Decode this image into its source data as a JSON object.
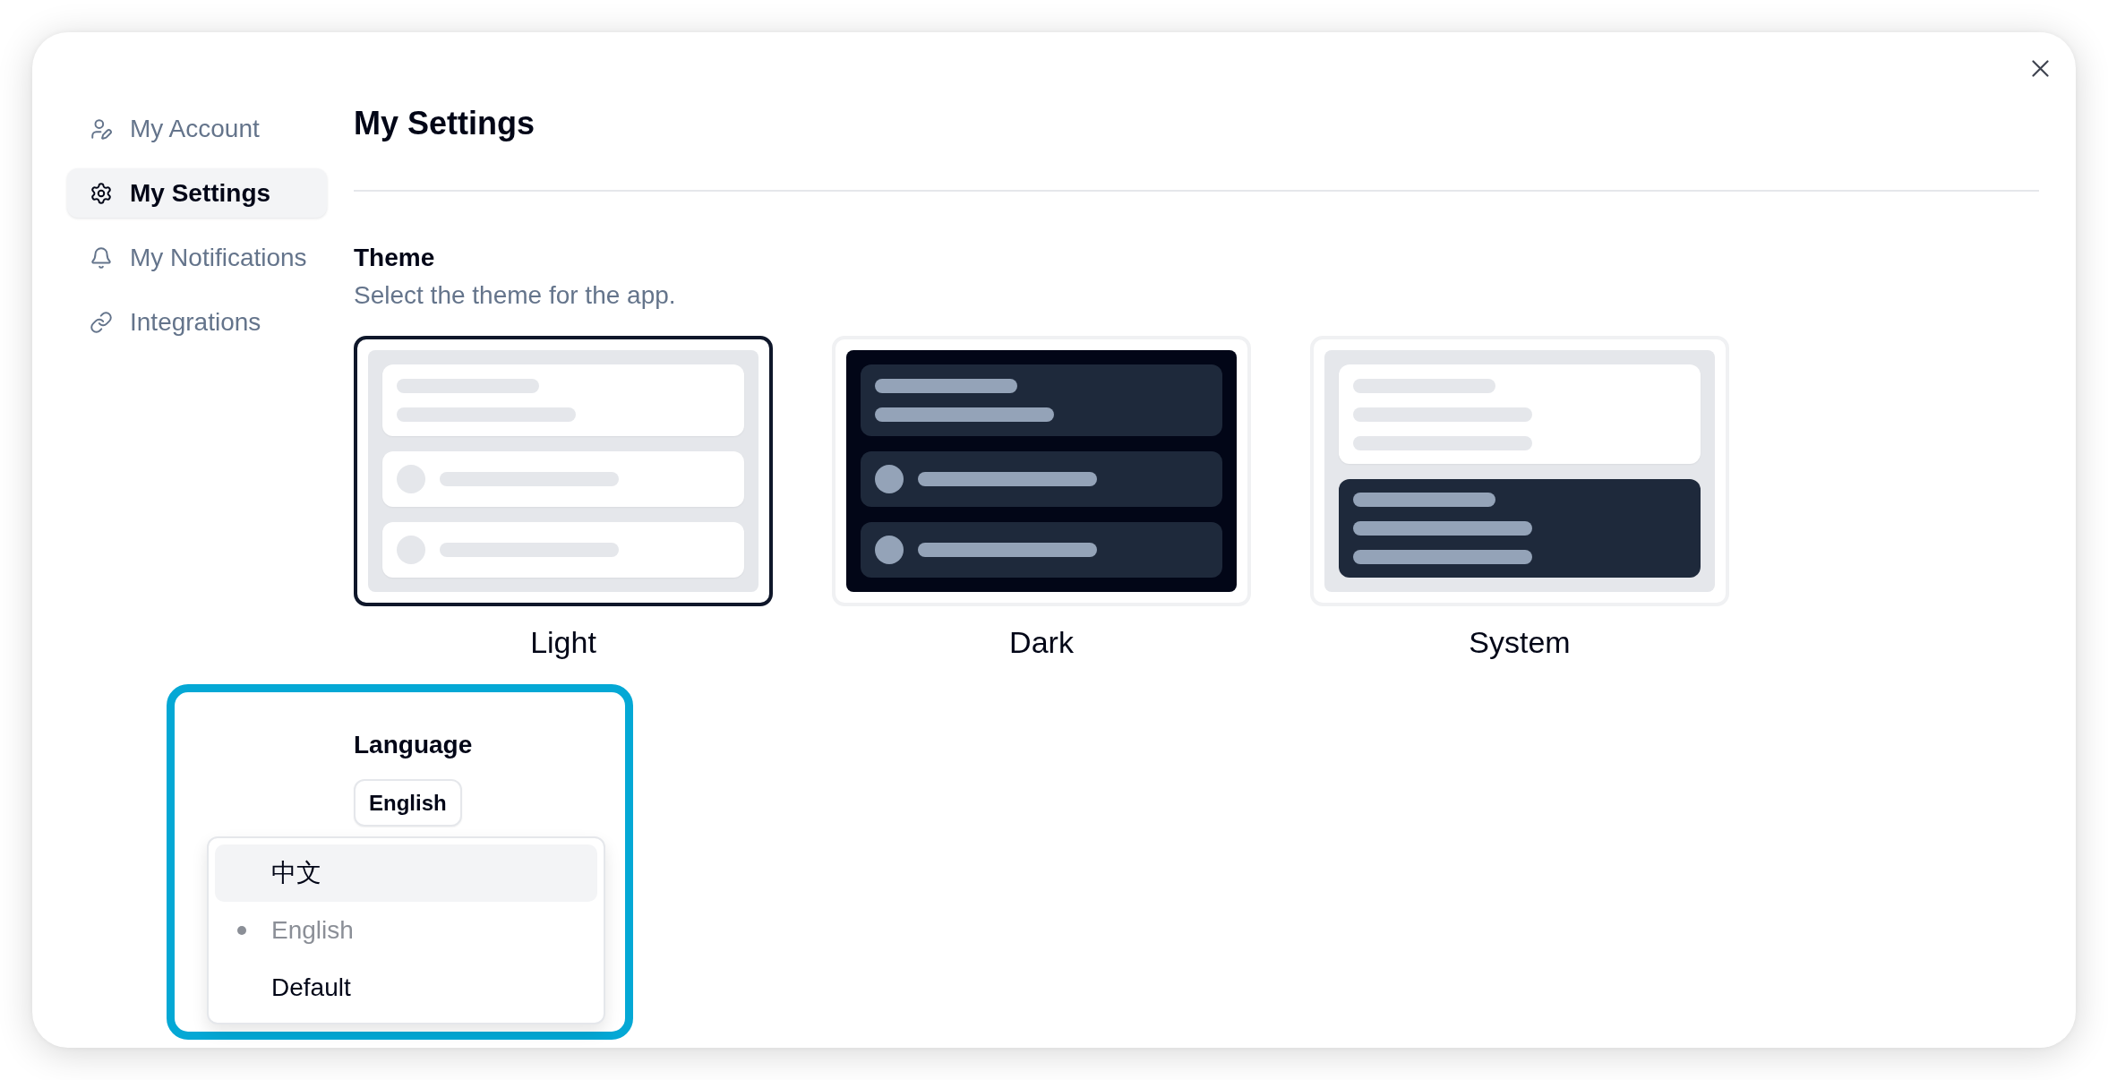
{
  "sidebar": {
    "items": [
      {
        "label": "My Account",
        "selected": false
      },
      {
        "label": "My Settings",
        "selected": true
      },
      {
        "label": "My Notifications",
        "selected": false
      },
      {
        "label": "Integrations",
        "selected": false
      }
    ]
  },
  "header": {
    "title": "My Settings"
  },
  "theme": {
    "label": "Theme",
    "description": "Select the theme for the app.",
    "options": [
      {
        "label": "Light",
        "kind": "light",
        "selected": true
      },
      {
        "label": "Dark",
        "kind": "dark",
        "selected": false
      },
      {
        "label": "System",
        "kind": "system",
        "selected": false
      }
    ]
  },
  "language": {
    "label": "Language",
    "select": {
      "value": "English",
      "expanded": true
    },
    "options": [
      {
        "label": "中文",
        "selected": false,
        "highlighted": true,
        "disabled": false
      },
      {
        "label": "English",
        "selected": true,
        "highlighted": false,
        "disabled": true
      },
      {
        "label": "Default",
        "selected": false,
        "highlighted": false,
        "disabled": false
      }
    ]
  }
}
